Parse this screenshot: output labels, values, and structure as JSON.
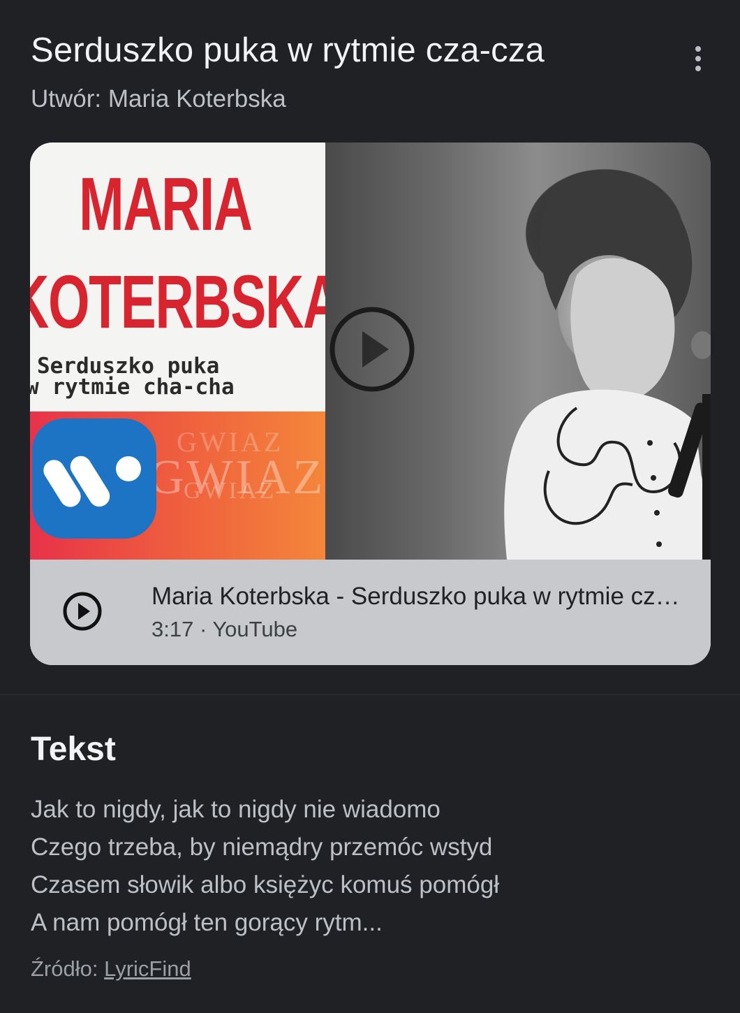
{
  "header": {
    "title": "Serduszko puka w rytmie cza-cza",
    "subtitle": "Utwór: Maria Koterbska",
    "more_icon": "more-vert-icon"
  },
  "video": {
    "thumbnail": {
      "brand_line1": "MARIA",
      "brand_line2": "KOTERBSKA",
      "album_line1": "Serduszko puka",
      "album_line2": "w rytmie cha-cha",
      "background_text": "GWIAZ"
    },
    "play_overlay_icon": "play-circle-icon",
    "title": "Maria Koterbska - Serduszko puka w rytmie cza-cza",
    "meta": "3:17 · YouTube",
    "play_icon": "play-circle-icon",
    "colors": {
      "card_bg": "#c7c9cd",
      "brand_red": "#d8242f",
      "label_blue": "#1e74c4"
    }
  },
  "lyrics": {
    "heading": "Tekst",
    "lines": [
      "Jak to nigdy, jak to nigdy nie wiadomo",
      "Czego trzeba, by niemądry przemóc wstyd",
      "Czasem słowik albo księżyc komuś pomógł",
      "A nam pomógł ten gorący rytm..."
    ],
    "source_prefix": "Źródło: ",
    "source_link": "LyricFind"
  },
  "theme": {
    "background": "#1f2125",
    "text_primary": "#f1f3f4",
    "text_secondary": "#bdc1c6"
  }
}
